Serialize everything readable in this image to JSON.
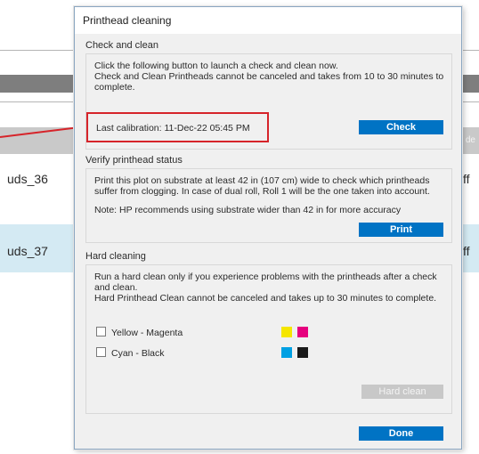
{
  "background": {
    "header_partial": "de",
    "rows": [
      {
        "left": "uds_36",
        "right": "ff"
      },
      {
        "left": "uds_37",
        "right": "ff"
      }
    ]
  },
  "dialog": {
    "title": "Printhead cleaning",
    "check_clean": {
      "label": "Check and clean",
      "line1": "Click the following button to launch a check and clean now.",
      "line2": "Check and Clean Printheads cannot be canceled and takes from 10 to 30 minutes to",
      "line3": "complete.",
      "last_calibration": "Last calibration: 11-Dec-22 05:45 PM",
      "button": "Check"
    },
    "verify": {
      "label": "Verify printhead status",
      "line1": "Print this plot on substrate at least 42 in (107 cm) wide to check which printheads",
      "line2": "suffer from clogging. In case of dual roll, Roll 1 will be the one taken into account.",
      "note": "Note: HP recommends using substrate wider than 42 in for more accuracy",
      "button": "Print"
    },
    "hard_clean": {
      "label": "Hard cleaning",
      "line1": "Run a hard clean only if you experience problems with the printheads after a check",
      "line2": "and clean.",
      "line3": "Hard Printhead Clean cannot be canceled and takes up to 30 minutes to complete.",
      "options": [
        {
          "label": "Yellow - Magenta",
          "checked": false,
          "colors": [
            "#f5e600",
            "#e6007e"
          ]
        },
        {
          "label": "Cyan - Black",
          "checked": false,
          "colors": [
            "#00a0e3",
            "#1a1a1a"
          ]
        }
      ],
      "button": "Hard clean"
    },
    "done_button": "Done"
  },
  "colors": {
    "accent_blue": "#0073c4",
    "highlight_red": "#d6242a",
    "selected_row": "#d4eaf3"
  }
}
